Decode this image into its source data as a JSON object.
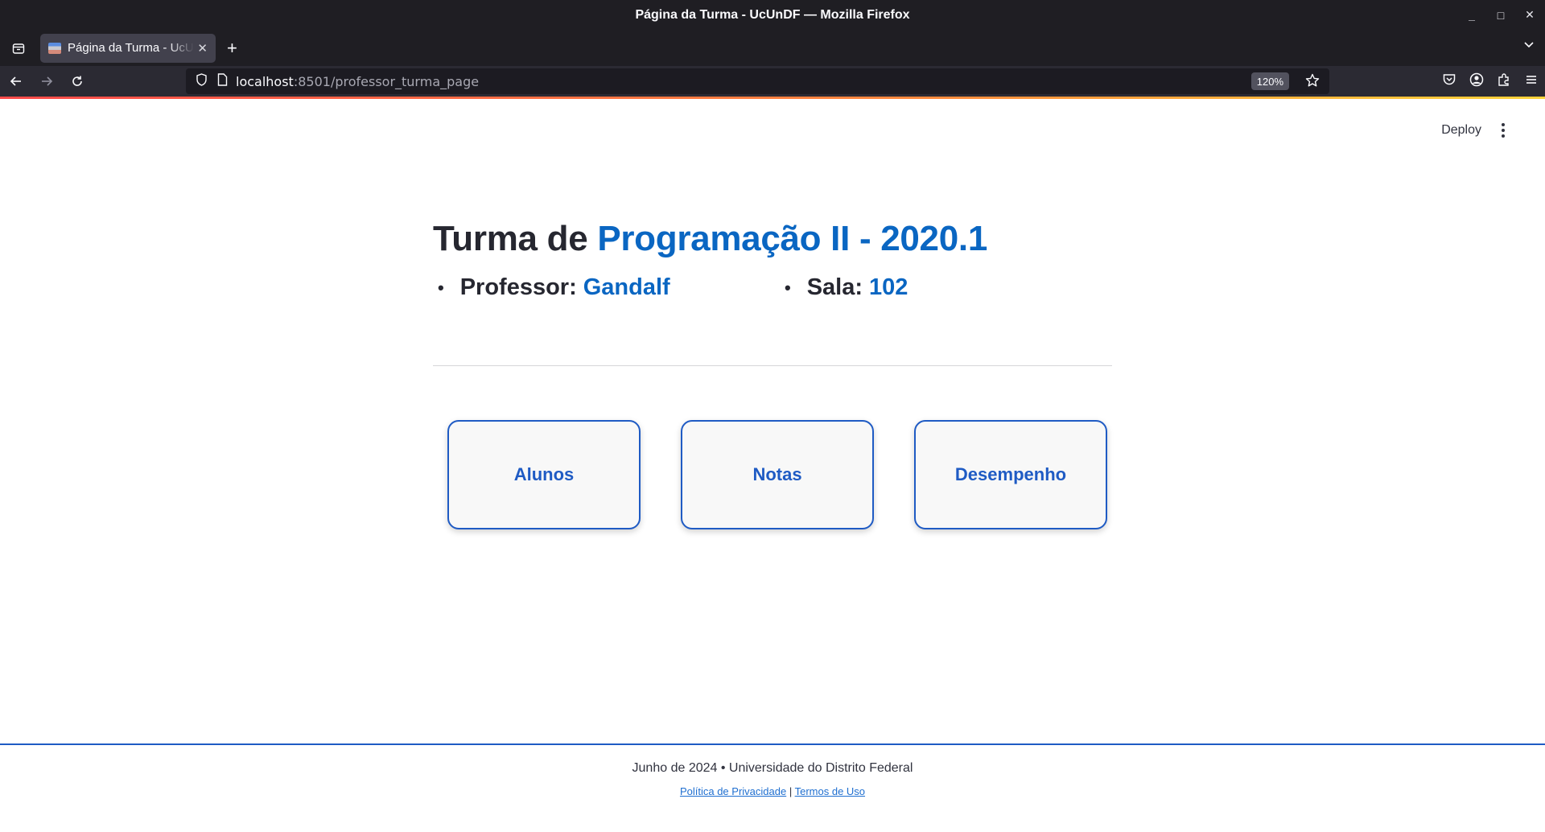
{
  "window": {
    "title": "Página da Turma - UcUnDF — Mozilla Firefox"
  },
  "tabs": [
    {
      "title": "Página da Turma - UcUnDF"
    }
  ],
  "address_bar": {
    "host": "localhost",
    "rest": ":8501/professor_turma_page",
    "zoom": "120%"
  },
  "streamlit": {
    "deploy_label": "Deploy"
  },
  "page": {
    "heading_prefix": "Turma de ",
    "heading_accent": "Programação II - 2020.1",
    "professor_label": "Professor:",
    "professor_value": "Gandalf",
    "sala_label": "Sala:",
    "sala_value": "102",
    "bullet": "•"
  },
  "cards": {
    "alunos": "Alunos",
    "notas": "Notas",
    "desempenho": "Desempenho"
  },
  "footer": {
    "line1": "Junho de 2024 • Universidade do Distrito Federal",
    "privacy": "Política de Privacidade",
    "separator": "|",
    "terms": "Termos de Uso"
  },
  "colors": {
    "accent_blue": "#0a66c2",
    "card_blue": "#1f5bc4",
    "chrome_dark": "#1f1e23"
  },
  "icons": [
    "firefox-view-icon",
    "new-tab-icon",
    "list-all-tabs-icon",
    "back-icon",
    "forward-icon",
    "reload-icon",
    "shield-icon",
    "page-icon",
    "bookmark-star-icon",
    "pocket-icon",
    "account-icon",
    "extensions-icon",
    "menu-icon",
    "kebab-menu-icon"
  ]
}
